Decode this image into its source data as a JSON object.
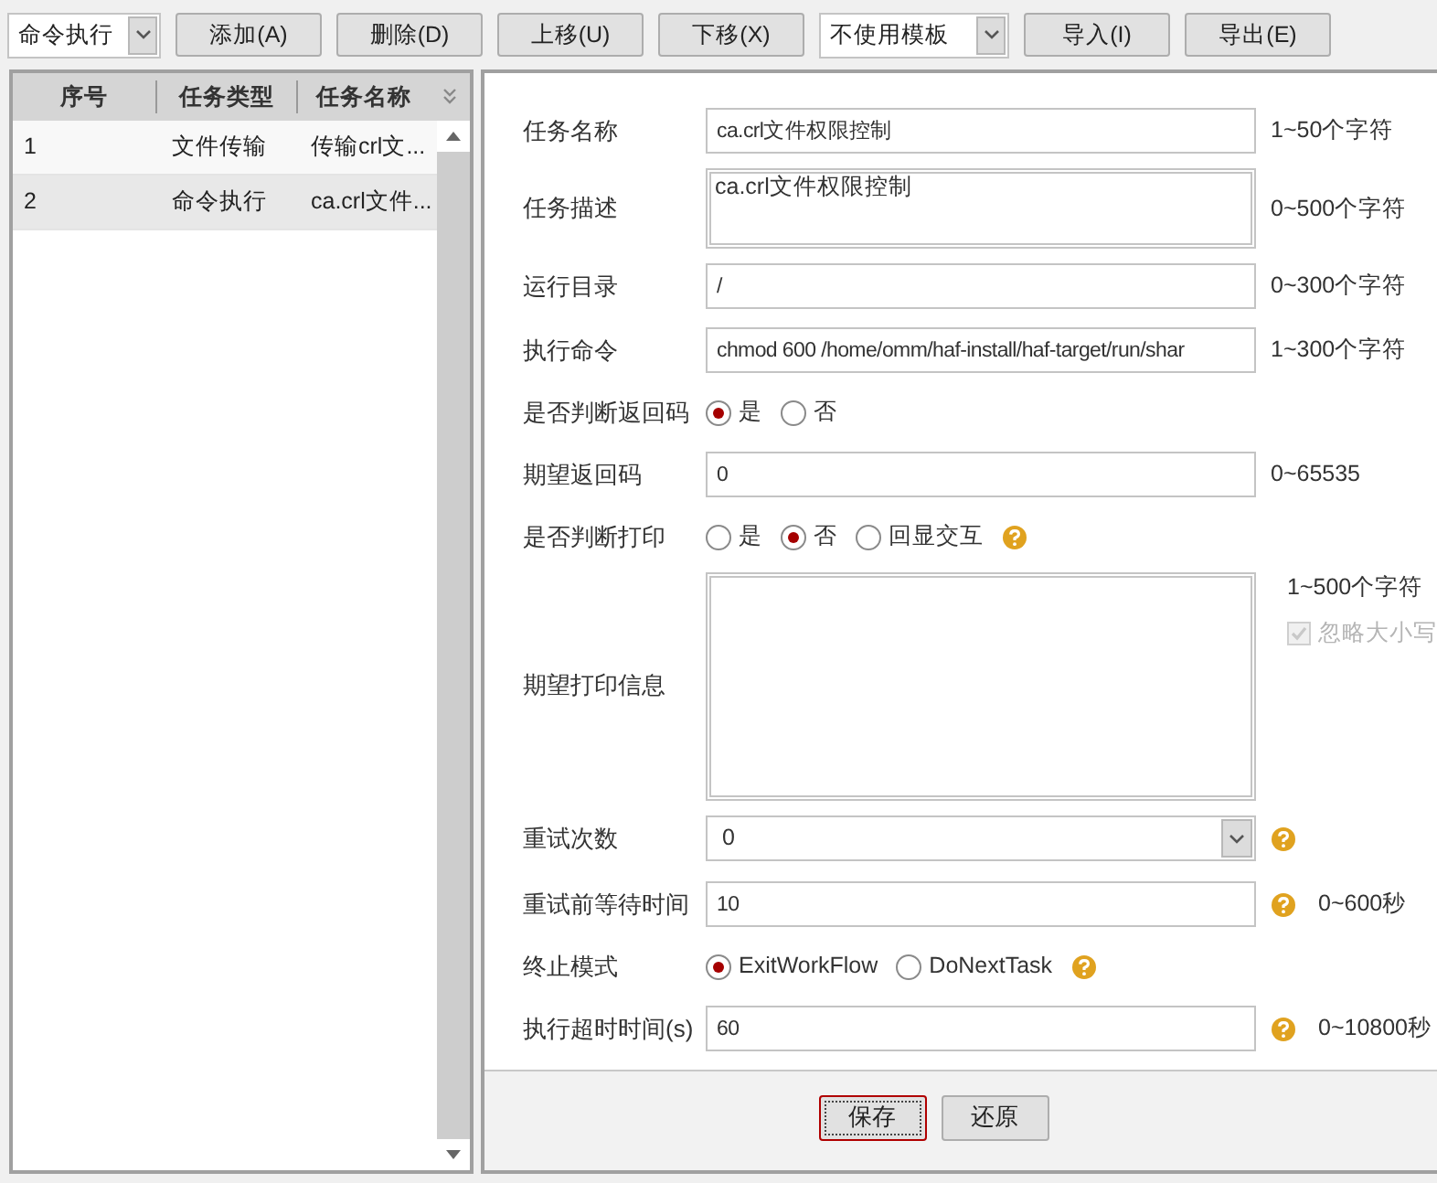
{
  "toolbar": {
    "items": [
      {
        "kind": "select",
        "value": "命令执行"
      },
      {
        "kind": "button",
        "label": "添加(A)"
      },
      {
        "kind": "button",
        "label": "删除(D)"
      },
      {
        "kind": "button",
        "label": "上移(U)"
      },
      {
        "kind": "button",
        "label": "下移(X)"
      },
      {
        "kind": "select",
        "value": "不使用模板"
      },
      {
        "kind": "button",
        "label": "导入(I)"
      },
      {
        "kind": "button",
        "label": "导出(E)"
      }
    ]
  },
  "task_table": {
    "columns": [
      "序号",
      "任务类型",
      "任务名称"
    ],
    "rows": [
      {
        "cells": [
          "1",
          "文件传输",
          "传输crl文..."
        ],
        "selected": false
      },
      {
        "cells": [
          "2",
          "命令执行",
          "ca.crl文件..."
        ],
        "selected": true
      }
    ]
  },
  "form": {
    "fields": [
      {
        "kind": "text",
        "label": "任务名称",
        "value": "ca.crl文件权限控制",
        "hint": "1~50个字符"
      },
      {
        "kind": "textarea",
        "label": "任务描述",
        "value": "ca.crl文件权限控制",
        "hint": "0~500个字符"
      },
      {
        "kind": "text",
        "label": "运行目录",
        "value": "/",
        "hint": "0~300个字符"
      },
      {
        "kind": "text",
        "label": "执行命令",
        "value": "chmod 600 /home/omm/haf-install/haf-target/run/shar",
        "hint": "1~300个字符"
      },
      {
        "kind": "radio",
        "label": "是否判断返回码",
        "options": [
          {
            "label": "是",
            "selected": true
          },
          {
            "label": "否",
            "selected": false
          }
        ]
      },
      {
        "kind": "text",
        "label": "期望返回码",
        "value": "0",
        "hint": "0~65535"
      },
      {
        "kind": "radio",
        "label": "是否判断打印",
        "options": [
          {
            "label": "是",
            "selected": false
          },
          {
            "label": "否",
            "selected": true
          },
          {
            "label": "回显交互",
            "selected": false
          }
        ],
        "help": true
      },
      {
        "kind": "bigtext",
        "label": "期望打印信息",
        "hint": "1~500个字符",
        "checkbox": {
          "label": "忽略大小写",
          "checked": true,
          "disabled": true
        }
      },
      {
        "kind": "select",
        "label": "重试次数",
        "value": "0",
        "help": true
      },
      {
        "kind": "text",
        "label": "重试前等待时间",
        "value": "10",
        "hint": "0~600秒",
        "help": true
      },
      {
        "kind": "radio",
        "label": "终止模式",
        "options": [
          {
            "label": "ExitWorkFlow",
            "selected": true
          },
          {
            "label": "DoNextTask",
            "selected": false
          }
        ],
        "help": true
      },
      {
        "kind": "text",
        "label": "执行超时时间(s)",
        "value": "60",
        "hint": "0~10800秒",
        "help": true
      }
    ]
  },
  "footer": {
    "buttons": [
      {
        "label": "保存",
        "focused": true
      },
      {
        "label": "还原",
        "focused": false
      }
    ]
  }
}
